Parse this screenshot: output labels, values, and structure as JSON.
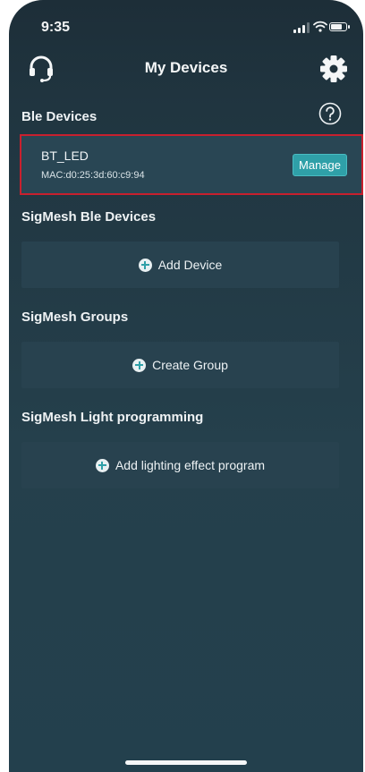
{
  "status_bar": {
    "time": "9:35"
  },
  "nav": {
    "title": "My Devices",
    "left_icon": "headset-icon",
    "right_icon": "gear-icon"
  },
  "ble_section": {
    "title": "Ble Devices",
    "help_icon": "question-circle-icon",
    "devices": [
      {
        "name": "BT_LED",
        "mac": "MAC:d0:25:3d:60:c9:94",
        "action_label": "Manage"
      }
    ]
  },
  "sigmesh_devices": {
    "title": "SigMesh Ble Devices",
    "action_label": "Add Device"
  },
  "sigmesh_groups": {
    "title": "SigMesh Groups",
    "action_label": "Create Group"
  },
  "sigmesh_programming": {
    "title": "SigMesh Light programming",
    "action_label": "Add lighting effect program"
  },
  "colors": {
    "background": "#23404d",
    "card": "#28424f",
    "accent": "#2fa0a8",
    "highlight_border": "#c8202e"
  },
  "battery_level": 0.8
}
